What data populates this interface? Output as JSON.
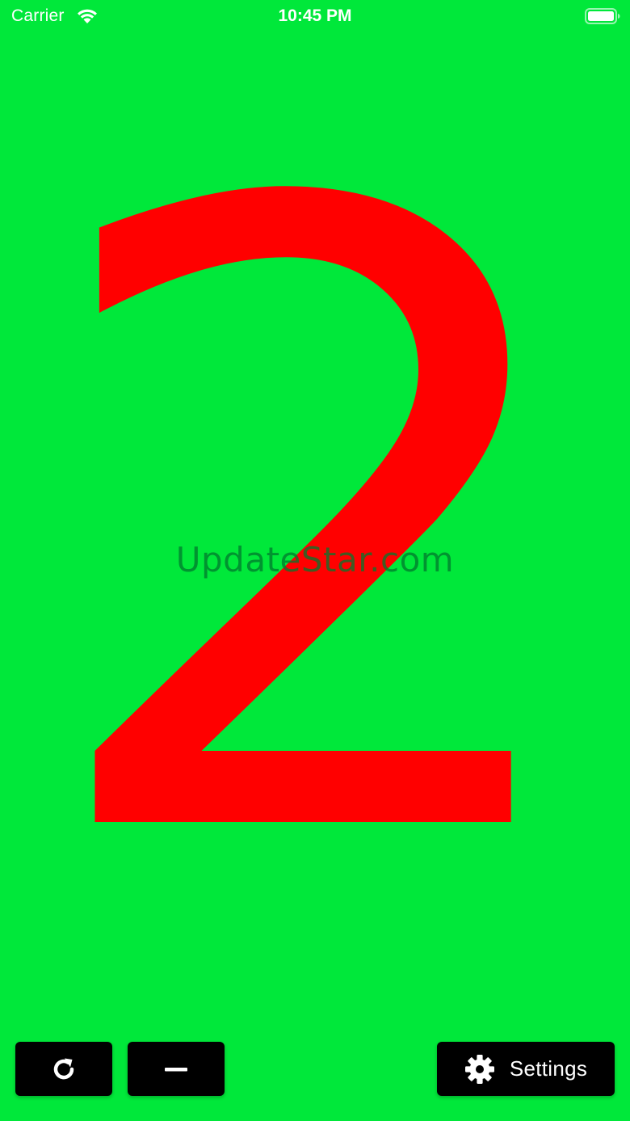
{
  "status_bar": {
    "carrier": "Carrier",
    "time": "10:45 PM",
    "wifi_icon": "wifi-icon",
    "battery_icon": "battery-icon"
  },
  "counter": {
    "value": "2",
    "digit_color": "#ff0000",
    "background_color": "#00e83a"
  },
  "watermark": {
    "text": "UpdateStar.com"
  },
  "toolbar": {
    "reset_icon": "refresh-icon",
    "minus_icon": "minus-icon",
    "settings_icon": "gear-icon",
    "settings_label": "Settings",
    "button_color": "#000000"
  }
}
